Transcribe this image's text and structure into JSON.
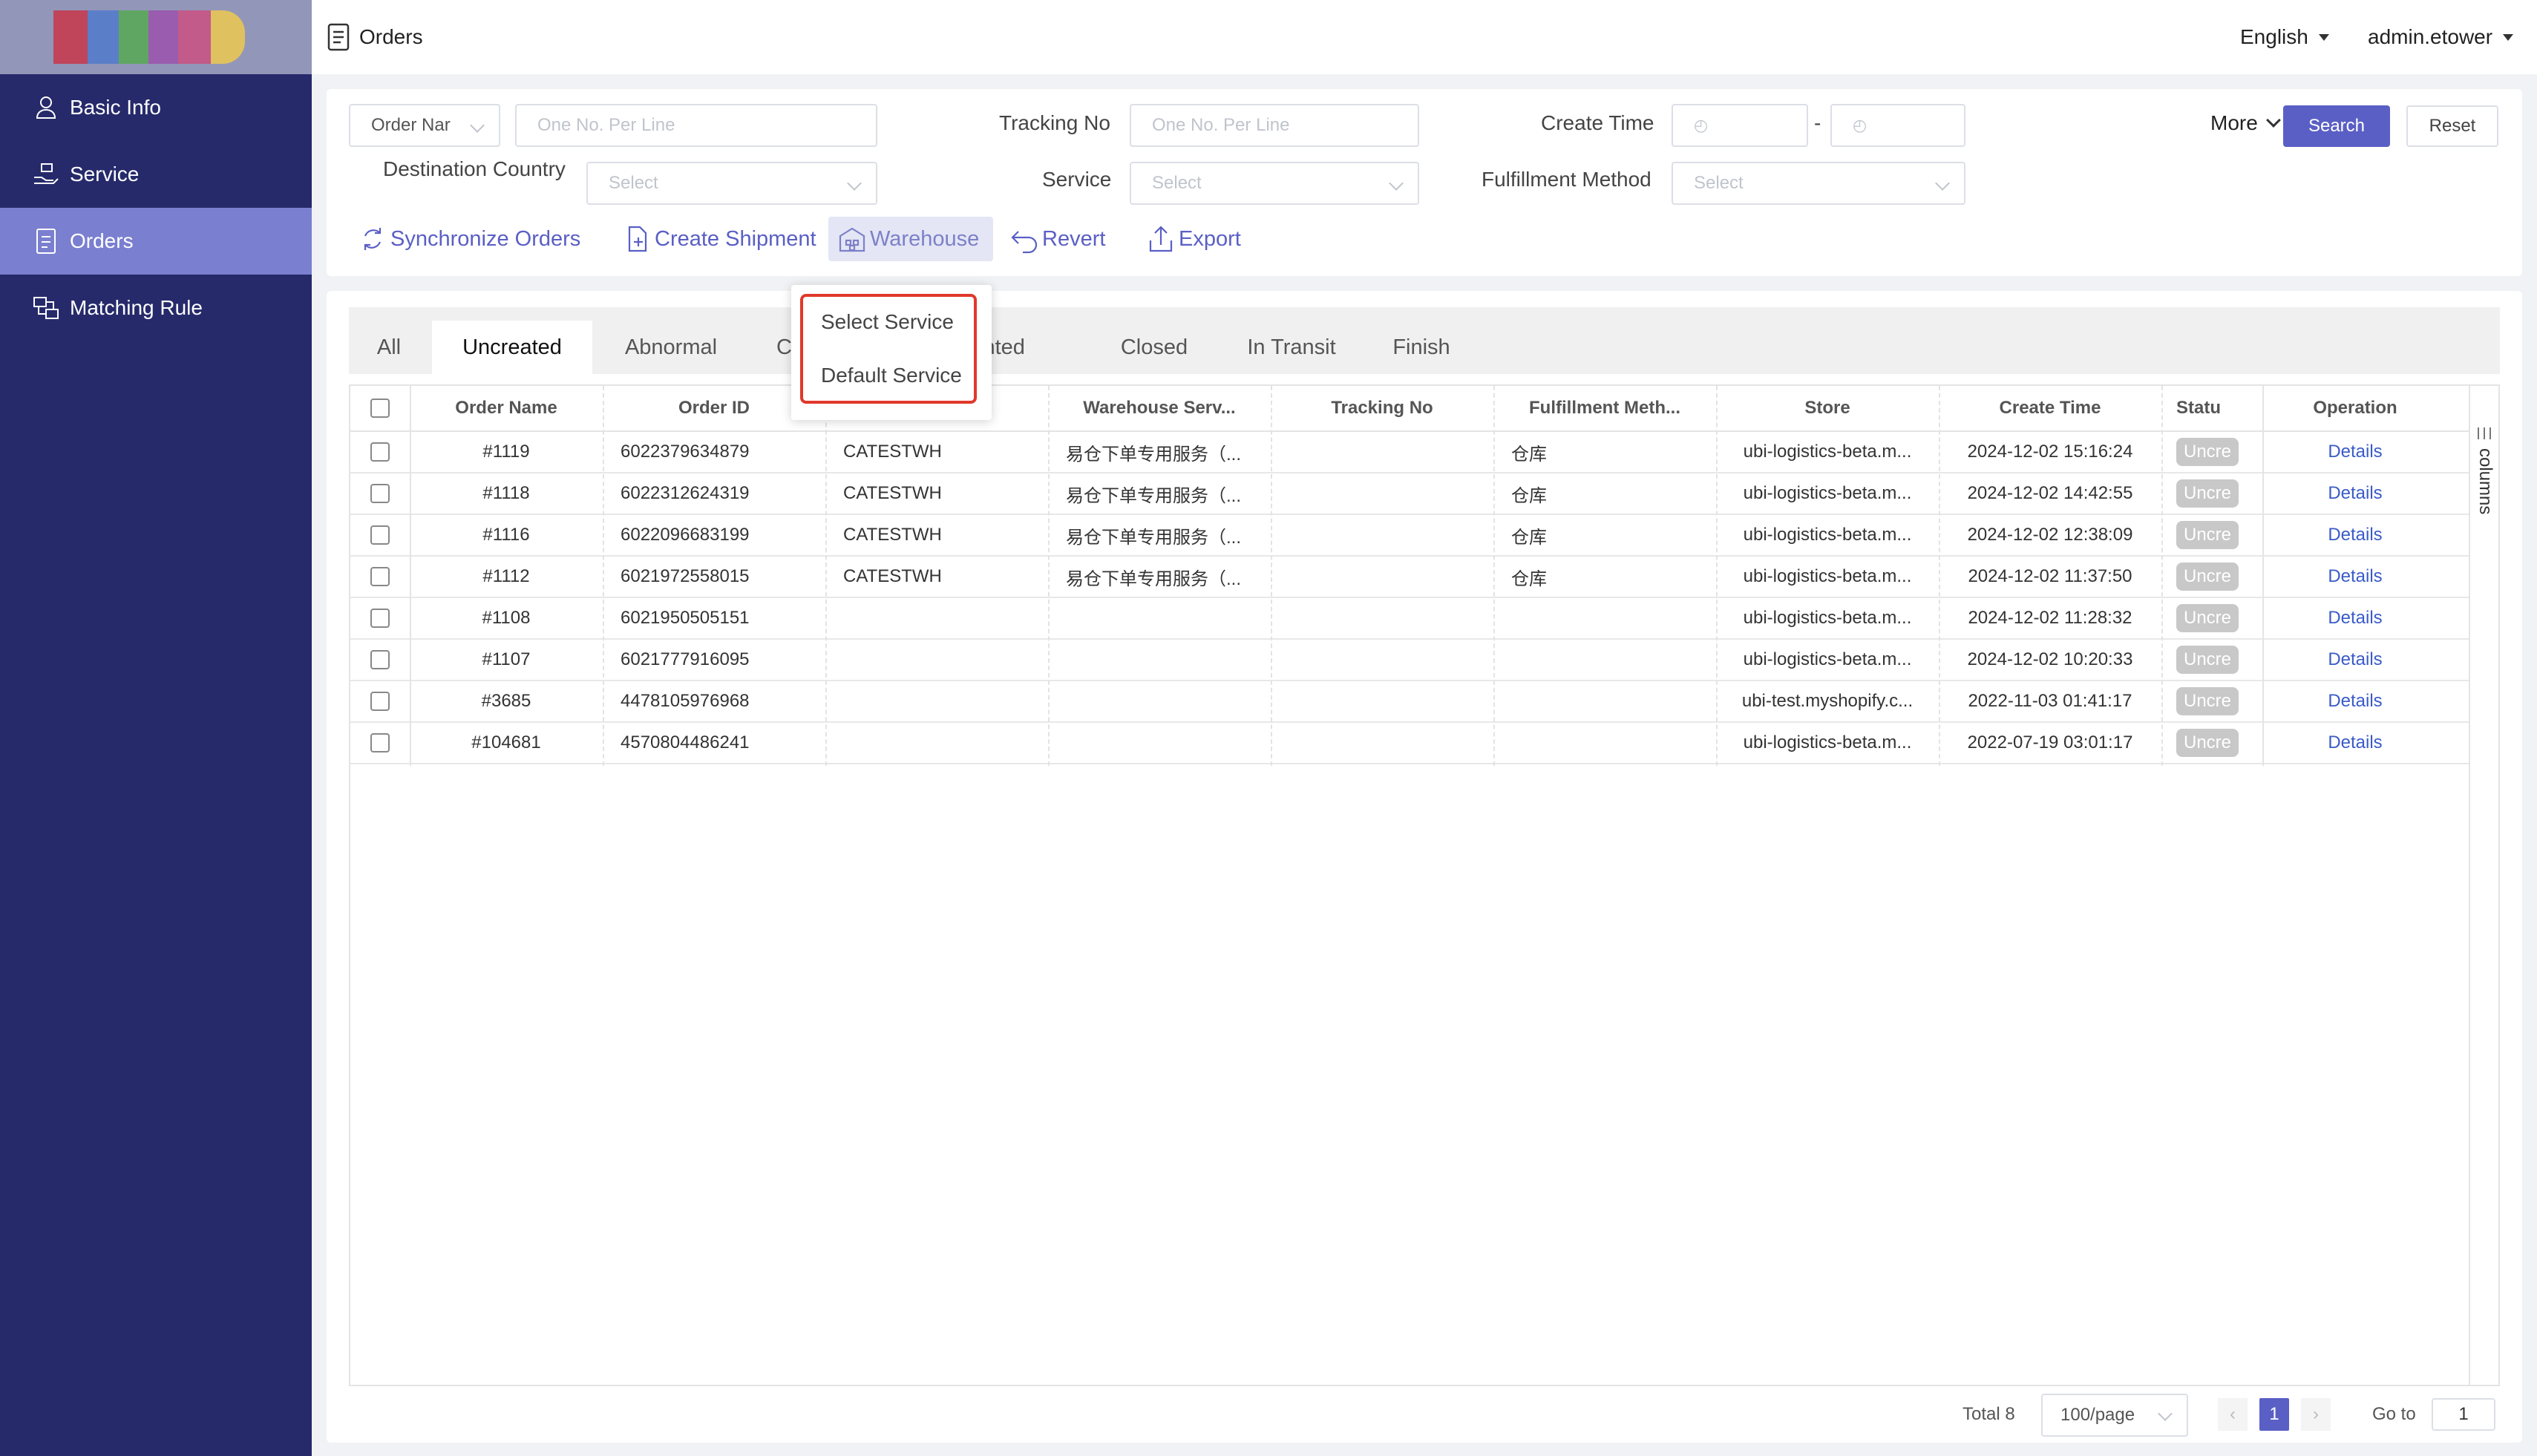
{
  "sidebar": {
    "items": [
      {
        "label": "Basic Info"
      },
      {
        "label": "Service"
      },
      {
        "label": "Orders"
      },
      {
        "label": "Matching Rule"
      }
    ]
  },
  "header": {
    "title": "Orders",
    "language": "English",
    "user": "admin.etower"
  },
  "filters": {
    "order_select": "Order Nar",
    "order_placeholder": "One No. Per Line",
    "tracking_label": "Tracking No",
    "tracking_placeholder": "One No. Per Line",
    "create_time_label": "Create Time",
    "date_sep": "-",
    "destination_label": "Destination Country",
    "destination_placeholder": "Select",
    "service_label": "Service",
    "service_placeholder": "Select",
    "fulfillment_label": "Fulfillment Method",
    "fulfillment_placeholder": "Select",
    "more": "More",
    "search": "Search",
    "reset": "Reset"
  },
  "actions": {
    "sync": "Synchronize Orders",
    "create": "Create Shipment",
    "warehouse": "Warehouse",
    "revert": "Revert",
    "export": "Export"
  },
  "dropdown": {
    "options": [
      "Select Service",
      "Default Service"
    ]
  },
  "tabs": [
    {
      "label": "All"
    },
    {
      "label": "Uncreated"
    },
    {
      "label": "Abnormal"
    },
    {
      "label": "C"
    },
    {
      "label": "inted"
    },
    {
      "label": "Closed"
    },
    {
      "label": "In Transit"
    },
    {
      "label": "Finish"
    }
  ],
  "table": {
    "columns": [
      "Order Name",
      "Order ID",
      "Warehouse Serv...",
      "Tracking No",
      "Fulfillment Meth...",
      "Store",
      "Create Time",
      "Statu",
      "Operation"
    ],
    "side_label": "columns",
    "rows": [
      {
        "name": "#1119",
        "id": "6022379634879",
        "service": "CATESTWH",
        "wh": "易仓下单专用服务（...",
        "tracking": "",
        "fulfill": "仓库",
        "store": "ubi-logistics-beta.m...",
        "time": "2024-12-02 15:16:24",
        "status": "Uncre",
        "op": "Details"
      },
      {
        "name": "#1118",
        "id": "6022312624319",
        "service": "CATESTWH",
        "wh": "易仓下单专用服务（...",
        "tracking": "",
        "fulfill": "仓库",
        "store": "ubi-logistics-beta.m...",
        "time": "2024-12-02 14:42:55",
        "status": "Uncre",
        "op": "Details"
      },
      {
        "name": "#1116",
        "id": "6022096683199",
        "service": "CATESTWH",
        "wh": "易仓下单专用服务（...",
        "tracking": "",
        "fulfill": "仓库",
        "store": "ubi-logistics-beta.m...",
        "time": "2024-12-02 12:38:09",
        "status": "Uncre",
        "op": "Details"
      },
      {
        "name": "#1112",
        "id": "6021972558015",
        "service": "CATESTWH",
        "wh": "易仓下单专用服务（...",
        "tracking": "",
        "fulfill": "仓库",
        "store": "ubi-logistics-beta.m...",
        "time": "2024-12-02 11:37:50",
        "status": "Uncre",
        "op": "Details"
      },
      {
        "name": "#1108",
        "id": "6021950505151",
        "service": "",
        "wh": "",
        "tracking": "",
        "fulfill": "",
        "store": "ubi-logistics-beta.m...",
        "time": "2024-12-02 11:28:32",
        "status": "Uncre",
        "op": "Details"
      },
      {
        "name": "#1107",
        "id": "6021777916095",
        "service": "",
        "wh": "",
        "tracking": "",
        "fulfill": "",
        "store": "ubi-logistics-beta.m...",
        "time": "2024-12-02 10:20:33",
        "status": "Uncre",
        "op": "Details"
      },
      {
        "name": "#3685",
        "id": "4478105976968",
        "service": "",
        "wh": "",
        "tracking": "",
        "fulfill": "",
        "store": "ubi-test.myshopify.c...",
        "time": "2022-11-03 01:41:17",
        "status": "Uncre",
        "op": "Details"
      },
      {
        "name": "#104681",
        "id": "4570804486241",
        "service": "",
        "wh": "",
        "tracking": "",
        "fulfill": "",
        "store": "ubi-logistics-beta.m...",
        "time": "2022-07-19 03:01:17",
        "status": "Uncre",
        "op": "Details"
      }
    ]
  },
  "pagination": {
    "total": "Total 8",
    "page_size": "100/page",
    "current": "1",
    "goto_label": "Go to",
    "goto_value": "1"
  },
  "colors": {
    "sidebar": "#262a6b",
    "active_nav": "#7a7fd0",
    "primary": "#5a5fc5",
    "highlight_border": "#e0392b"
  }
}
